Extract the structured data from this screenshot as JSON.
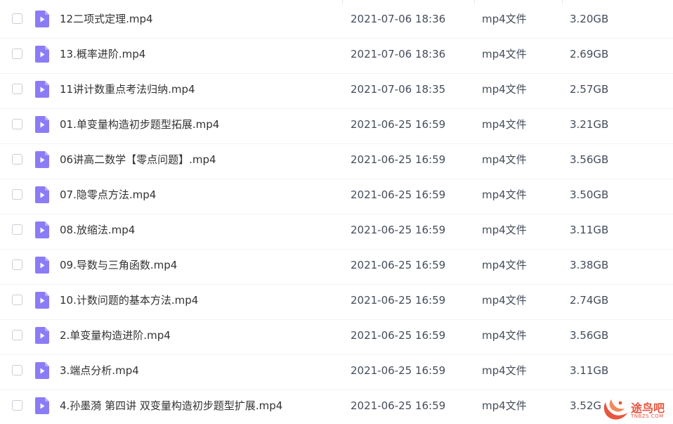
{
  "files": [
    {
      "name": "12二项式定理.mp4",
      "date": "2021-07-06 18:36",
      "type": "mp4文件",
      "size": "3.20GB"
    },
    {
      "name": "13.概率进阶.mp4",
      "date": "2021-07-06 18:36",
      "type": "mp4文件",
      "size": "2.69GB"
    },
    {
      "name": "11讲计数重点考法归纳.mp4",
      "date": "2021-07-06 18:35",
      "type": "mp4文件",
      "size": "2.57GB"
    },
    {
      "name": "01.单变量构造初步题型拓展.mp4",
      "date": "2021-06-25 16:59",
      "type": "mp4文件",
      "size": "3.21GB"
    },
    {
      "name": "06讲高二数学【零点问题】.mp4",
      "date": "2021-06-25 16:59",
      "type": "mp4文件",
      "size": "3.56GB"
    },
    {
      "name": "07.隐零点方法.mp4",
      "date": "2021-06-25 16:59",
      "type": "mp4文件",
      "size": "3.50GB"
    },
    {
      "name": "08.放缩法.mp4",
      "date": "2021-06-25 16:59",
      "type": "mp4文件",
      "size": "3.11GB"
    },
    {
      "name": "09.导数与三角函数.mp4",
      "date": "2021-06-25 16:59",
      "type": "mp4文件",
      "size": "3.38GB"
    },
    {
      "name": "10.计数问题的基本方法.mp4",
      "date": "2021-06-25 16:59",
      "type": "mp4文件",
      "size": "2.74GB"
    },
    {
      "name": "2.单变量构造进阶.mp4",
      "date": "2021-06-25 16:59",
      "type": "mp4文件",
      "size": "3.56GB"
    },
    {
      "name": "3.端点分析.mp4",
      "date": "2021-06-25 16:59",
      "type": "mp4文件",
      "size": "3.11GB"
    },
    {
      "name": "4.孙墨漪 第四讲 双变量构造初步题型扩展.mp4",
      "date": "2021-06-25 16:59",
      "type": "mp4文件",
      "size": "3.52G"
    }
  ],
  "watermark": {
    "text": "途鸟吧",
    "sub": "TNBZS.COM",
    "color": "#e8553e"
  },
  "colors": {
    "file_icon": "#8b7cf6",
    "text_primary": "#333333",
    "text_secondary": "#454d5a"
  },
  "icons": {
    "file": "video-file-icon",
    "checkbox": "checkbox"
  }
}
